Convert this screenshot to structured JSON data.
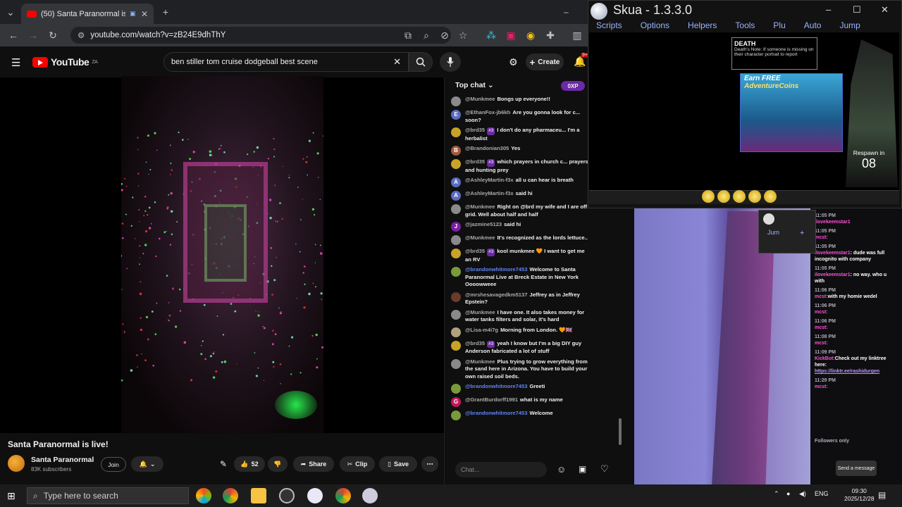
{
  "browser": {
    "tab_title": "(50) Santa Paranormal is live!",
    "url": "youtube.com/watch?v=zB24E9dhThY"
  },
  "youtube": {
    "logo_text": "YouTube",
    "region": "ZA",
    "search_query": "ben stiller tom cruise dodgeball best scene",
    "create_label": "Create",
    "notifications_count": "9+"
  },
  "video": {
    "title": "Santa Paranormal is live!",
    "channel": "Santa Paranormal",
    "subscribers": "83K subscribers",
    "join_label": "Join",
    "likes": "52",
    "share_label": "Share",
    "clip_label": "Clip",
    "save_label": "Save"
  },
  "chat": {
    "header": "Top chat",
    "xp_label": "0XP",
    "input_placeholder": "Chat...",
    "messages": [
      {
        "author": "@Munkmee",
        "text": "Bongs up everyone!!",
        "color": "#8a8a8a",
        "initial": ""
      },
      {
        "author": "@EthanFox-jb6kh",
        "text": "Are you gonna look for c... soon?",
        "color": "#5c6bc0",
        "initial": "E"
      },
      {
        "author": "@brd35",
        "badge": "#3",
        "text": "I don't do any pharmaceu... I'm a herbalist",
        "color": "#c9a227",
        "initial": ""
      },
      {
        "author": "@Brandonian305",
        "text": "Yes",
        "color": "#a05a3a",
        "initial": "B"
      },
      {
        "author": "@brd35",
        "badge": "#3",
        "text": "which prayers in church c... prayers and hunting prey",
        "color": "#c9a227",
        "initial": ""
      },
      {
        "author": "@AshleyMartin-f3x",
        "text": "all u can hear is breath",
        "color": "#5c6bc0",
        "initial": "A"
      },
      {
        "author": "@AshleyMartin-f3x",
        "text": "said hi",
        "color": "#5c6bc0",
        "initial": "A"
      },
      {
        "author": "@Munkmee",
        "text": "Right on @brd my wife and I are off grid. Well about half and half",
        "color": "#8a8a8a",
        "initial": ""
      },
      {
        "author": "@jazmine5123",
        "text": "said hi",
        "color": "#7b1fa2",
        "initial": "J"
      },
      {
        "author": "@Munkmee",
        "text": "It's recognized as the lords lettuce..",
        "color": "#8a8a8a",
        "initial": ""
      },
      {
        "author": "@brd35",
        "badge": "#3",
        "text": "kool munkmee 🧡 I want to get me an RV",
        "color": "#c9a227",
        "initial": ""
      },
      {
        "author": "@brandonwhitmore7453",
        "mod": true,
        "text": "Welcome to Santa Paranormal Live at Breck Estate in New York Oooowweee",
        "color": "#7a9a3a",
        "initial": ""
      },
      {
        "author": "@mrshesavagedkm5137",
        "text": "Jeffrey as in Jeffrey Epstein?",
        "color": "#6a3a2a",
        "initial": ""
      },
      {
        "author": "@Munkmee",
        "text": "I have one. It also takes money for water tanks filters and solar, it's hard",
        "color": "#8a8a8a",
        "initial": ""
      },
      {
        "author": "@Lisa-m4i7g",
        "text": "Morning from London. 🧡🇬🇧",
        "color": "#b0a080",
        "initial": ""
      },
      {
        "author": "@brd35",
        "badge": "#3",
        "text": "yeah I know but I'm a big DIY guy Anderson fabricated a lot of stuff",
        "color": "#c9a227",
        "initial": ""
      },
      {
        "author": "@Munkmee",
        "text": "Plus trying to grow everything from the sand here in Arizona. You have to build your own raised soil beds.",
        "color": "#8a8a8a",
        "initial": ""
      },
      {
        "author": "@brandonwhitmore7453",
        "mod": true,
        "text": "Greeti",
        "color": "#7a9a3a",
        "initial": ""
      },
      {
        "author": "@GrantBurdorff1991",
        "text": "what is my name",
        "color": "#c2185b",
        "initial": "G"
      },
      {
        "author": "@brandonwhitmore7453",
        "mod": true,
        "text": "Welcome",
        "color": "#7a9a3a",
        "initial": ""
      }
    ]
  },
  "skua": {
    "title": "Skua - 1.3.3.0",
    "menu": [
      "Scripts",
      "Options",
      "Helpers",
      "Tools",
      "Plu",
      "Auto",
      "Jump"
    ],
    "death_title": "DEATH",
    "death_note": "Death's Note: If someone is missing on their character portrait to report",
    "promo_line1": "Earn FREE",
    "promo_line2": "AdventureCoins",
    "respawn_label": "Respawn in",
    "respawn_count": "08",
    "mini_label": "Jum"
  },
  "twitch_chat": {
    "lines": [
      {
        "time": "11:05 PM",
        "name": "ilovekeemstar1",
        "msg": ""
      },
      {
        "time": "11:05 PM",
        "name": "mcst:",
        "msg": ""
      },
      {
        "time": "11:05 PM",
        "name": "ilovekeemstar1",
        "msg": ": dude was full incognito with company"
      },
      {
        "time": "11:05 PM",
        "name": "ilovekeemstar1",
        "msg": ": no way. who u with"
      },
      {
        "time": "11:06 PM",
        "name": "mcst:",
        "msg": "with my homie wedel"
      },
      {
        "time": "11:06 PM",
        "name": "mcst:",
        "msg": ""
      },
      {
        "time": "11:06 PM",
        "name": "mcst:",
        "msg": ""
      },
      {
        "time": "11:08 PM",
        "name": "mcst:",
        "msg": ""
      },
      {
        "time": "11:09 PM",
        "name": "KickBot:",
        "msg": "Check out my linktree here:",
        "link": "https://linktr.ee/rashidurgen"
      },
      {
        "time": "11:29 PM",
        "name": "mcst:",
        "msg": ""
      }
    ],
    "followers_only": "Followers only",
    "send_label": "Send a message"
  },
  "taskbar": {
    "search_placeholder": "Type here to search",
    "lang": "ENG",
    "time": "09:30",
    "date": "2025/12/28"
  }
}
